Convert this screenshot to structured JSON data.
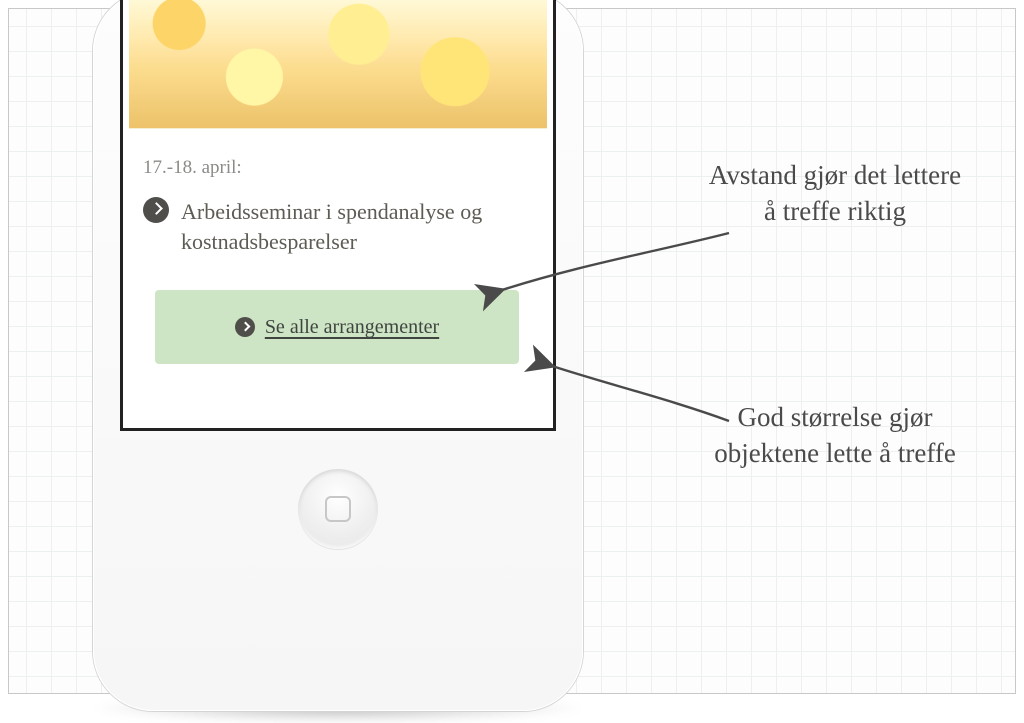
{
  "event": {
    "date_label": "17.-18. april:",
    "title": "Arbeidsseminar i spendanalyse og kostnadsbesparelser"
  },
  "cta": {
    "label": "Se alle arrangementer"
  },
  "annotations": {
    "spacing": "Avstand gjør det lettere å treffe riktig",
    "size": "God størrelse gjør objektene lette å treffe"
  }
}
